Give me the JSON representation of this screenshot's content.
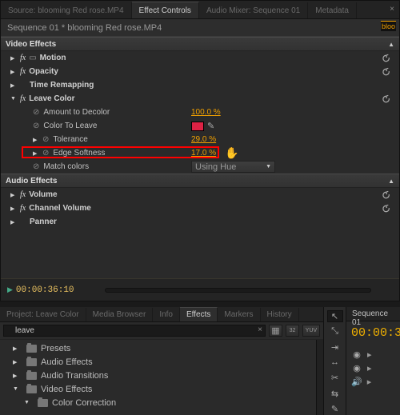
{
  "top_tabs": {
    "source": "Source: blooming Red rose.MP4",
    "effect_controls": "Effect Controls",
    "audio_mixer": "Audio Mixer: Sequence 01",
    "metadata": "Metadata"
  },
  "sequence_header": "Sequence 01 * blooming Red rose.MP4",
  "seq_badge": "bloo",
  "sections": {
    "video": "Video Effects",
    "audio": "Audio Effects"
  },
  "effects": {
    "motion": "Motion",
    "opacity": "Opacity",
    "time_remap": "Time Remapping",
    "leave_color": {
      "label": "Leave Color",
      "amount_to_decolor": {
        "label": "Amount to Decolor",
        "value": "100.0 %"
      },
      "color_to_leave": {
        "label": "Color To Leave",
        "swatch": "#dd2244"
      },
      "tolerance": {
        "label": "Tolerance",
        "value": "29.0 %"
      },
      "edge_softness": {
        "label": "Edge Softness",
        "value": "17.0 %"
      },
      "match_colors": {
        "label": "Match colors",
        "value": "Using Hue"
      }
    },
    "volume": "Volume",
    "channel_volume": "Channel Volume",
    "panner": "Panner"
  },
  "timecode_current": "00:00:36:10",
  "project_tabs": {
    "project": "Project: Leave Color",
    "media_browser": "Media Browser",
    "info": "Info",
    "effects": "Effects",
    "markers": "Markers",
    "history": "History"
  },
  "search": {
    "value": "leave",
    "placeholder": ""
  },
  "mini_buttons": {
    "b1": "▶",
    "b2": "32",
    "b3": "YUV"
  },
  "tree": {
    "presets": "Presets",
    "audio_effects": "Audio Effects",
    "audio_transitions": "Audio Transitions",
    "video_effects": "Video Effects",
    "color_correction": "Color Correction"
  },
  "timeline": {
    "tab": "Sequence 01",
    "time": "00:00:3"
  }
}
